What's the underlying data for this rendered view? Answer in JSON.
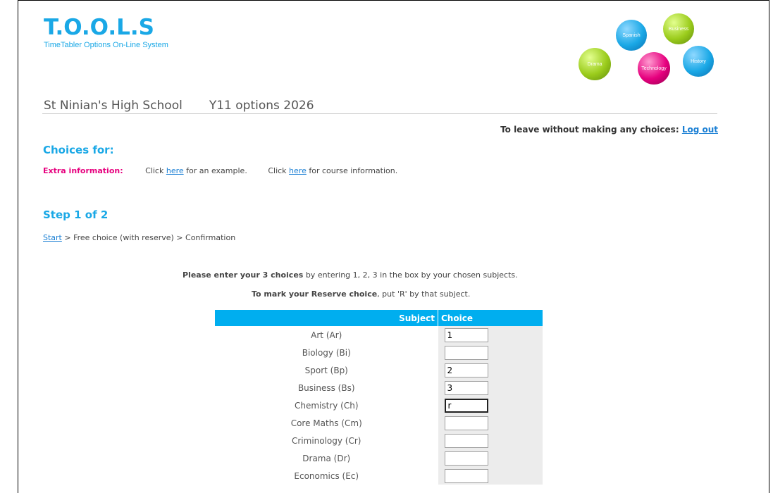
{
  "logo": {
    "title": "T.O.O.L.S",
    "subtitle": "TimeTabler Options On-Line System"
  },
  "decor_balls": [
    {
      "label": "Spanish",
      "color": "#1aa8e6"
    },
    {
      "label": "Business",
      "color": "#9bcc1c"
    },
    {
      "label": "Drama",
      "color": "#9bcc1c"
    },
    {
      "label": "Technology",
      "color": "#e6007e"
    },
    {
      "label": "History",
      "color": "#1aa8e6"
    }
  ],
  "header": {
    "school": "St Ninian's High School",
    "options_title": "Y11 options 2026"
  },
  "logout": {
    "prompt": "To leave without making any choices:",
    "link": "Log out"
  },
  "choices_for": "Choices for:",
  "extra": {
    "label": "Extra information:",
    "click1": "Click",
    "here1": "here",
    "after1": "for an example.",
    "click2": "Click",
    "here2": "here",
    "after2": "for course information."
  },
  "step": "Step 1 of 2",
  "breadcrumb": {
    "start": "Start",
    "rest": "> Free choice (with reserve) > Confirmation"
  },
  "instructions": {
    "line1_bold": "Please enter your 3 choices",
    "line1_rest": " by entering 1, 2, 3 in the box by your chosen subjects.",
    "line2_bold": "To mark your Reserve choice",
    "line2_rest": ", put 'R' by that subject."
  },
  "table": {
    "headers": {
      "subject": "Subject",
      "choice": "Choice"
    },
    "rows": [
      {
        "subject": "Art (Ar)",
        "value": "1"
      },
      {
        "subject": "Biology (Bi)",
        "value": ""
      },
      {
        "subject": "Sport (Bp)",
        "value": "2"
      },
      {
        "subject": "Business (Bs)",
        "value": "3"
      },
      {
        "subject": "Chemistry (Ch)",
        "value": "r"
      },
      {
        "subject": "Core Maths (Cm)",
        "value": ""
      },
      {
        "subject": "Criminology (Cr)",
        "value": ""
      },
      {
        "subject": "Drama (Dr)",
        "value": ""
      },
      {
        "subject": "Economics (Ec)",
        "value": ""
      }
    ]
  },
  "colors": {
    "accent": "#1aa8e6",
    "header_bg": "#00aeef",
    "magenta": "#e6007e"
  }
}
